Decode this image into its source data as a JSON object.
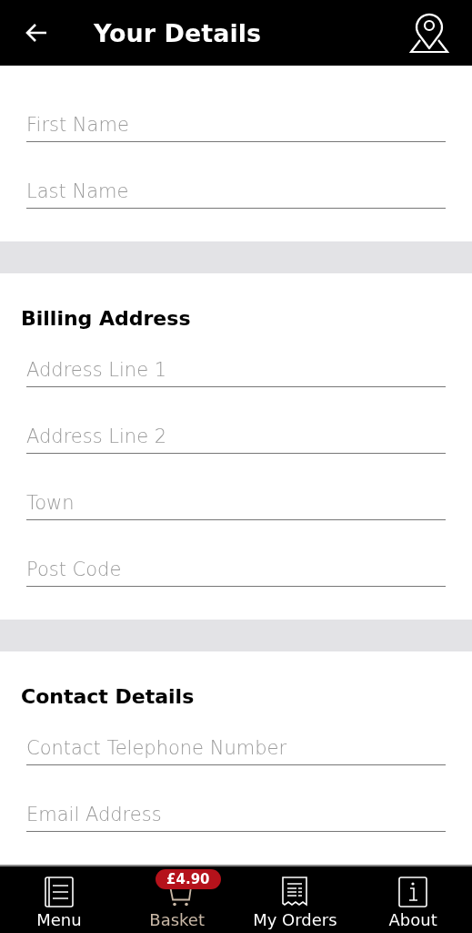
{
  "header": {
    "title": "Your Details"
  },
  "sections": [
    {
      "fields": [
        {
          "placeholder": "First Name"
        },
        {
          "placeholder": "Last Name"
        }
      ]
    },
    {
      "title": "Billing Address",
      "fields": [
        {
          "placeholder": "Address Line 1"
        },
        {
          "placeholder": "Address Line 2"
        },
        {
          "placeholder": "Town"
        },
        {
          "placeholder": "Post Code"
        }
      ]
    },
    {
      "title": "Contact Details",
      "fields": [
        {
          "placeholder": "Contact Telephone Number"
        },
        {
          "placeholder": "Email Address"
        }
      ]
    }
  ],
  "nav": [
    {
      "kind": "menu",
      "label": "Menu",
      "selected": false
    },
    {
      "kind": "basket",
      "label": "Basket",
      "selected": true,
      "badge": "£4.90"
    },
    {
      "kind": "orders",
      "label": "My Orders",
      "selected": false
    },
    {
      "kind": "about",
      "label": "About",
      "selected": false
    }
  ]
}
